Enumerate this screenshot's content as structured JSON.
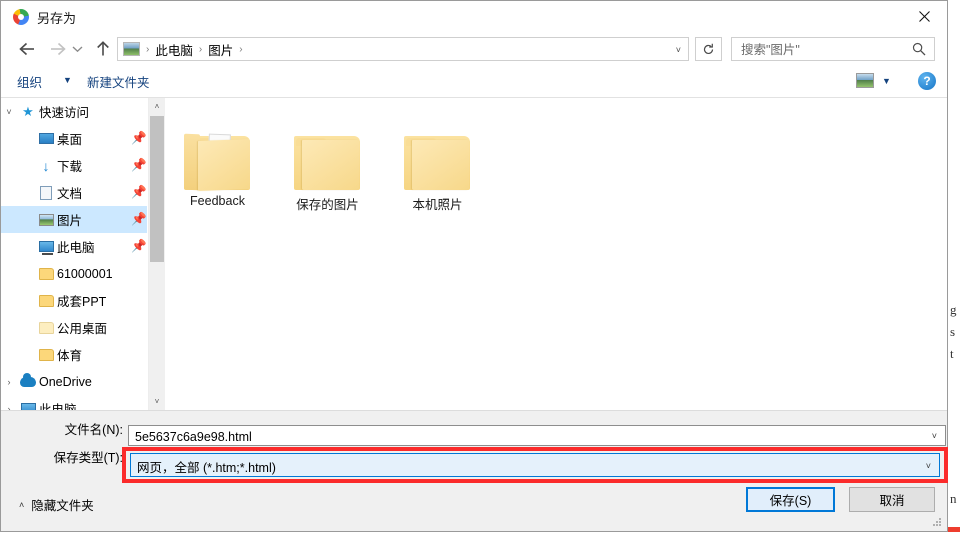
{
  "window": {
    "title": "另存为",
    "app_icon": "chrome-icon",
    "close_label": "✕"
  },
  "nav": {
    "back": "←",
    "forward": "→",
    "recent": "˅",
    "up": "↑"
  },
  "address": {
    "icon": "pictures-icon",
    "separator": "›",
    "crumbs": [
      "此电脑",
      "图片"
    ],
    "dropdown_caret": "˅",
    "refresh": "↻"
  },
  "search": {
    "placeholder": "搜索\"图片\"",
    "value": "",
    "icon": "search-icon"
  },
  "command_bar": {
    "organize": "组织",
    "organize_caret": "▼",
    "new_folder": "新建文件夹",
    "view_caret": "▼",
    "help": "?"
  },
  "sidebar": {
    "scroll": {
      "up": "˄",
      "down": "˅"
    },
    "items": [
      {
        "label": "快速访问",
        "icon": "star-pin-icon",
        "expander": "˅",
        "indent": false,
        "pinned": false,
        "selected": false
      },
      {
        "label": "桌面",
        "icon": "desktop-icon",
        "expander": "",
        "indent": true,
        "pinned": true,
        "selected": false
      },
      {
        "label": "下载",
        "icon": "download-icon",
        "expander": "",
        "indent": true,
        "pinned": true,
        "selected": false
      },
      {
        "label": "文档",
        "icon": "document-icon",
        "expander": "",
        "indent": true,
        "pinned": true,
        "selected": false
      },
      {
        "label": "图片",
        "icon": "pictures-icon",
        "expander": "",
        "indent": true,
        "pinned": true,
        "selected": true
      },
      {
        "label": "此电脑",
        "icon": "this-pc-icon",
        "expander": "",
        "indent": true,
        "pinned": true,
        "selected": false
      },
      {
        "label": "61000001",
        "icon": "folder-icon",
        "expander": "",
        "indent": true,
        "pinned": false,
        "selected": false
      },
      {
        "label": "成套PPT",
        "icon": "folder-icon",
        "expander": "",
        "indent": true,
        "pinned": false,
        "selected": false
      },
      {
        "label": "公用桌面",
        "icon": "folder-pale-icon",
        "expander": "",
        "indent": true,
        "pinned": false,
        "selected": false
      },
      {
        "label": "体育",
        "icon": "folder-icon",
        "expander": "",
        "indent": true,
        "pinned": false,
        "selected": false
      },
      {
        "label": "OneDrive",
        "icon": "onedrive-cloud-icon",
        "expander": "›",
        "indent": false,
        "pinned": false,
        "selected": false
      },
      {
        "label": "此电脑",
        "icon": "this-pc-icon",
        "expander": "›",
        "indent": false,
        "pinned": false,
        "selected": false
      }
    ]
  },
  "files": [
    {
      "name": "Feedback",
      "type": "folder-open"
    },
    {
      "name": "保存的图片",
      "type": "folder"
    },
    {
      "name": "本机照片",
      "type": "folder"
    }
  ],
  "form": {
    "filename_label": "文件名(N):",
    "filename_value": "5e5637c6a9e98.html",
    "filetype_label": "保存类型(T):",
    "filetype_value": "网页，全部 (*.htm;*.html)",
    "caret": "˅",
    "highlight_color": "#fb2b2b"
  },
  "footer": {
    "hide_folders": "隐藏文件夹",
    "hide_folders_chevron": "˄",
    "save": "保存(S)",
    "cancel": "取消"
  },
  "background": {
    "fragments": [
      "g",
      "s",
      "t",
      "n"
    ]
  }
}
